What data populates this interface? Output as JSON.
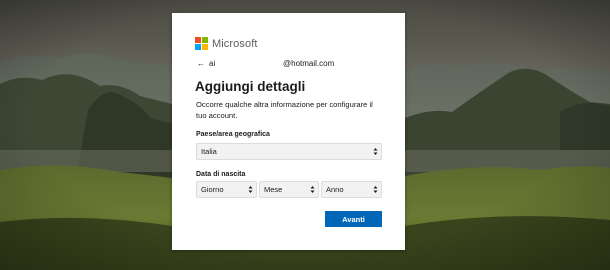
{
  "brand": {
    "name": "Microsoft",
    "logo_colors": [
      "#f25022",
      "#7fba00",
      "#00a4ef",
      "#ffb900"
    ]
  },
  "identity": {
    "back_icon": "back-arrow-icon",
    "user": "ai",
    "domain": "@hotmail.com"
  },
  "heading": "Aggiungi dettagli",
  "description": "Occorre qualche altra informazione per configurare il tuo account.",
  "country": {
    "label": "Paese/area geografica",
    "value": "Italia"
  },
  "birthdate": {
    "label": "Data di nascita",
    "day": "Giorno",
    "month": "Mese",
    "year": "Anno"
  },
  "next_button": "Avanti",
  "colors": {
    "accent": "#0067b8",
    "card": "#ffffff",
    "select_bg": "#f2f2f2"
  }
}
